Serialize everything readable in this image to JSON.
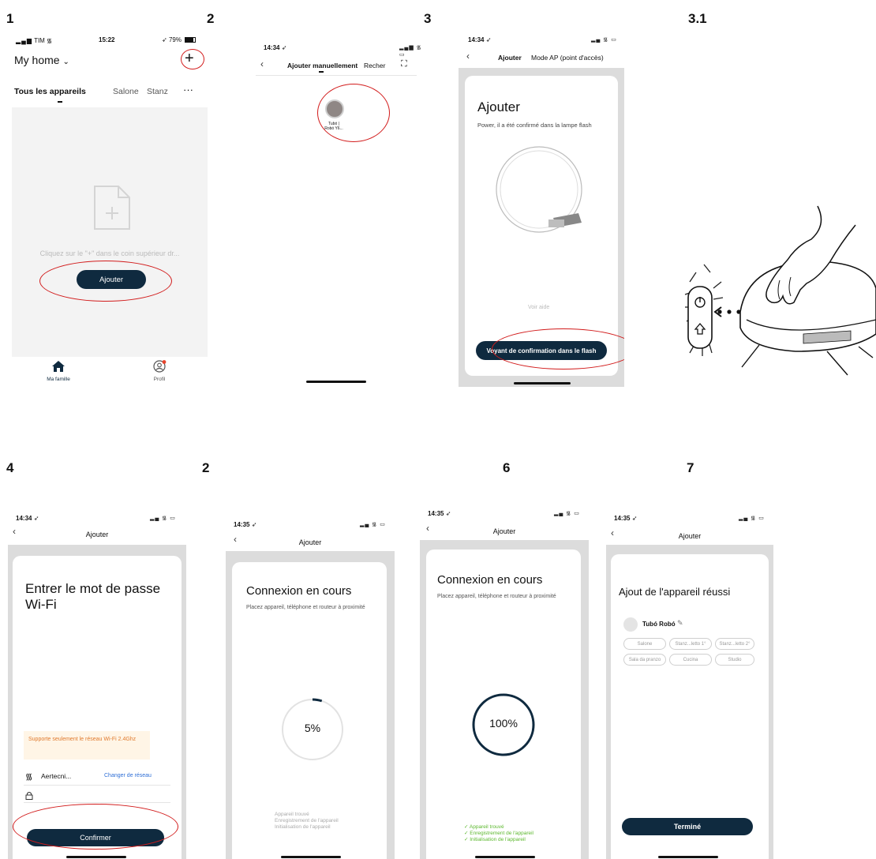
{
  "steps": {
    "s1": "1",
    "s2": "2",
    "s3": "3",
    "s31": "3.1",
    "s4": "4",
    "s5": "2",
    "s6": "6",
    "s7": "7"
  },
  "screen1": {
    "carrier": "TIM",
    "time": "15:22",
    "battery": "79%",
    "home_title": "My home",
    "tabs": [
      "Tous les appareils",
      "Salone",
      "Stanz"
    ],
    "more": "···",
    "empty_hint": "Cliquez sur le \"+\" dans le coin supérieur dr...",
    "add_button": "Ajouter",
    "nav_home": "Ma famille",
    "nav_profile": "Profil"
  },
  "screen2": {
    "time": "14:34",
    "tab_manual": "Ajouter manuellement",
    "tab_search": "Recher",
    "device_label_1": "Tubó |",
    "device_label_2": "Robó Y6..."
  },
  "screen3": {
    "time": "14:34",
    "tab_add": "Ajouter",
    "tab_ap": "Mode AP (point d'accès)",
    "title": "Ajouter",
    "subtitle": "Power, il a été confirmé dans la lampe flash",
    "help": "Voir aide",
    "confirm_button": "Voyant de confirmation dans le flash"
  },
  "screen4": {
    "time": "14:34",
    "header": "Ajouter",
    "title": "Entrer le mot de passe Wi-Fi",
    "warning": "Supporte seulement le réseau Wi-Fi 2.4Ghz",
    "network": "Aertecni...",
    "change_network": "Changer de réseau",
    "confirm_button": "Confirmer"
  },
  "screen5": {
    "time": "14:35",
    "header": "Ajouter",
    "title": "Connexion en cours",
    "subtitle": "Placez appareil, téléphone et routeur à proximité",
    "progress_label": "5%",
    "progress": 0.05,
    "steps": [
      "Appareil trouvé",
      "Enregistrement de l'appareil",
      "Initialisation de l'appareil"
    ]
  },
  "screen6": {
    "time": "14:35",
    "header": "Ajouter",
    "title": "Connexion en cours",
    "subtitle": "Placez appareil, téléphone et routeur à proximité",
    "progress_label": "100%",
    "progress": 1.0,
    "steps": [
      "✓ Appareil trouvé",
      "✓ Enregistrement de l'appareil",
      "✓ Initialisation de l'appareil"
    ]
  },
  "screen7": {
    "time": "14:35",
    "header": "Ajouter",
    "title": "Ajout de l'appareil réussi",
    "device_name": "Tubó Robó",
    "rooms": [
      "Salone",
      "Stanz...letto 1°",
      "Stanz...letto 2°",
      "Sala da pranzo",
      "Cucina",
      "Studio"
    ],
    "done_button": "Terminé"
  },
  "colors": {
    "dark_button": "#0f2a3f",
    "highlight_ring": "#d21c1c",
    "success_green": "#5cb82e",
    "warning_orange": "#e07a2e",
    "link_blue": "#2f6fd6"
  }
}
